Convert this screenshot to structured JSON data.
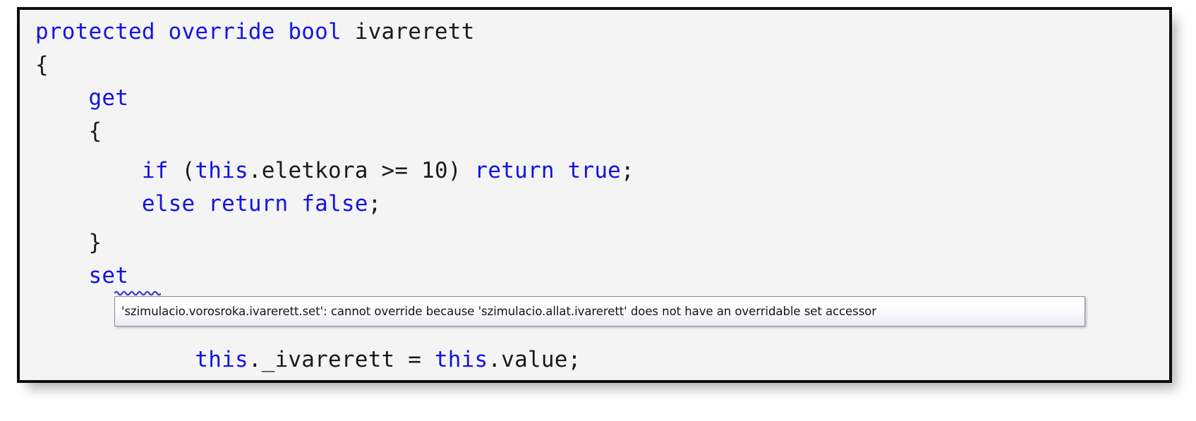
{
  "editor": {
    "name": "visual-studio-code-editor-snippet",
    "background_color": "#f4f4f4",
    "border_color": "#0d0d0d",
    "keyword_color": "#1414e0",
    "plain_text_color": "#1a1a1a",
    "font_size_px": 31,
    "lines": [
      {
        "index": 0,
        "indent": "",
        "segments": [
          {
            "text": "protected override bool ",
            "type": "keyword"
          },
          {
            "text": "ivarerett",
            "type": "plain"
          }
        ],
        "plain": "protected override bool ivarerett"
      },
      {
        "index": 1,
        "indent": "",
        "segments": [
          {
            "text": "{",
            "type": "plain"
          }
        ],
        "plain": "{"
      },
      {
        "index": 2,
        "indent": "    ",
        "segments": [
          {
            "text": "get",
            "type": "keyword"
          }
        ],
        "plain": "    get"
      },
      {
        "index": 3,
        "indent": "    ",
        "segments": [
          {
            "text": "{",
            "type": "plain"
          }
        ],
        "plain": "    {"
      },
      {
        "index": 4,
        "indent": "        ",
        "segments": [
          {
            "text": "if ",
            "type": "keyword"
          },
          {
            "text": "(",
            "type": "plain"
          },
          {
            "text": "this",
            "type": "keyword"
          },
          {
            "text": ".eletkora >= 10) ",
            "type": "plain"
          },
          {
            "text": "return true",
            "type": "keyword"
          },
          {
            "text": ";",
            "type": "plain"
          }
        ],
        "plain": "        if (this.eletkora >= 10) return true;"
      },
      {
        "index": 5,
        "indent": "        ",
        "segments": [
          {
            "text": "else return false",
            "type": "keyword"
          },
          {
            "text": ";",
            "type": "plain"
          }
        ],
        "plain": "        else return false;"
      },
      {
        "index": 6,
        "indent": "    ",
        "segments": [
          {
            "text": "}",
            "type": "plain"
          }
        ],
        "plain": "    }"
      },
      {
        "index": 7,
        "indent": "    ",
        "segments": [
          {
            "text": "set",
            "type": "keyword"
          }
        ],
        "plain": "    set",
        "has_error_squiggle": true
      },
      {
        "index": 8,
        "indent": "            ",
        "segments": [
          {
            "text": "this",
            "type": "keyword"
          },
          {
            "text": "._ivarerett = ",
            "type": "plain"
          },
          {
            "text": "this",
            "type": "keyword"
          },
          {
            "text": ".value;",
            "type": "plain"
          }
        ],
        "plain": "            this._ivarerett = this.value;"
      }
    ]
  },
  "error_squiggle": {
    "target_token": "set",
    "color": "#3a3ad8"
  },
  "tooltip": {
    "name": "compiler-error-tooltip",
    "message": "'szimulacio.vorosroka.ivarerett.set': cannot override because 'szimulacio.allat.ivarerett' does not have an overridable set accessor",
    "border_color": "#8b8b8b",
    "background_color": "#f7f6fb"
  }
}
